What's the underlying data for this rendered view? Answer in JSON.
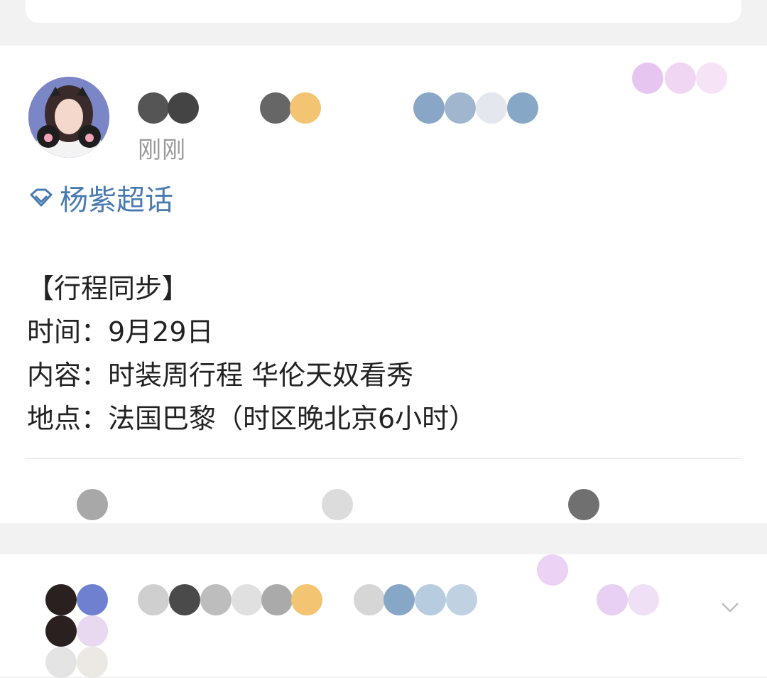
{
  "post": {
    "timestamp": "刚刚",
    "topic": "杨紫超话",
    "content": {
      "line1": "【行程同步】",
      "line2": "时间：9月29日",
      "line3": "内容：时装周行程 华伦天奴看秀",
      "line4": "地点：法国巴黎（时区晚北京6小时）"
    }
  },
  "icons": {
    "topic": "diamond-icon",
    "more": "chevron-down-icon"
  },
  "colors": {
    "topic_link": "#4a7bb0",
    "timestamp": "#9a9a9a",
    "page_bg": "#f2f2f2"
  }
}
